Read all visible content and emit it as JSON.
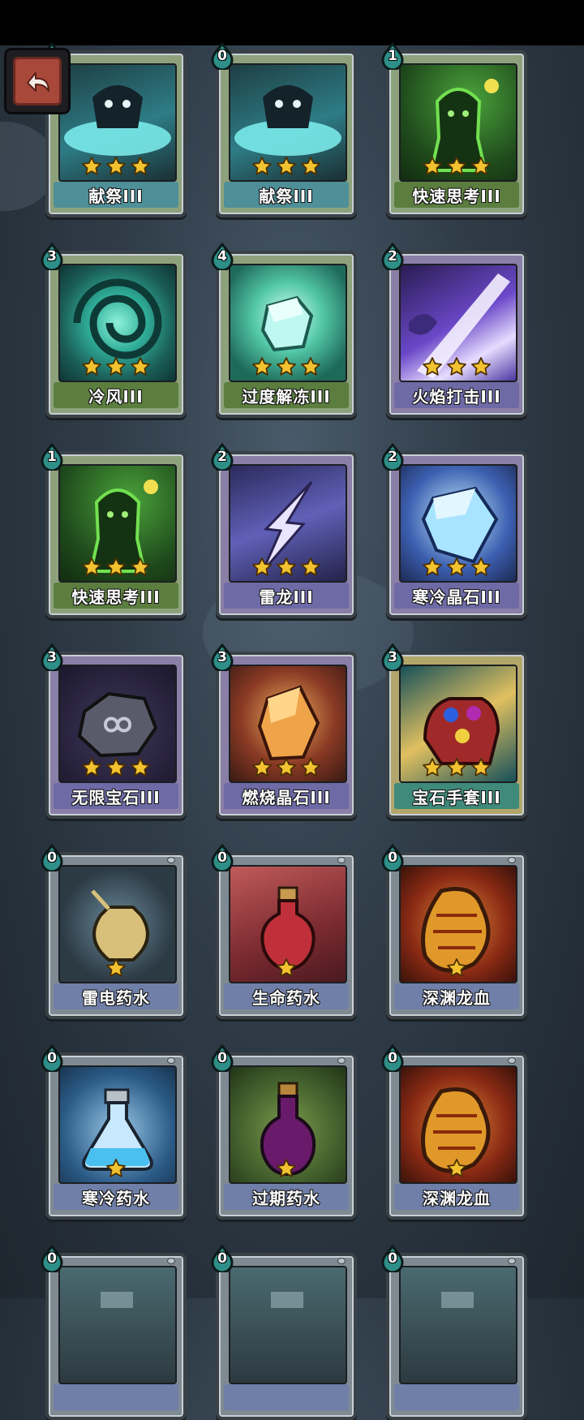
{
  "colors": {
    "star": "#f2c230",
    "cost_drop": "#2e8f88",
    "back_button": "#a8483a"
  },
  "back_button": {
    "icon": "return-arrow-icon"
  },
  "cards": [
    {
      "name": "献祭III",
      "cost": "",
      "stars": 3,
      "frame": "green",
      "label": "teal",
      "art": "sacrifice"
    },
    {
      "name": "献祭III",
      "cost": "0",
      "stars": 3,
      "frame": "green",
      "label": "teal",
      "art": "sacrifice"
    },
    {
      "name": "快速思考III",
      "cost": "1",
      "stars": 3,
      "frame": "green",
      "label": "green",
      "art": "quick-think"
    },
    {
      "name": "冷风III",
      "cost": "3",
      "stars": 3,
      "frame": "green",
      "label": "green",
      "art": "cold-wind"
    },
    {
      "name": "过度解冻III",
      "cost": "4",
      "stars": 3,
      "frame": "green",
      "label": "green",
      "art": "ice-cube"
    },
    {
      "name": "火焰打击III",
      "cost": "2",
      "stars": 3,
      "frame": "purple",
      "label": "purple",
      "art": "flame-strike"
    },
    {
      "name": "快速思考III",
      "cost": "1",
      "stars": 3,
      "frame": "green",
      "label": "green",
      "art": "quick-think"
    },
    {
      "name": "雷龙III",
      "cost": "2",
      "stars": 3,
      "frame": "purple",
      "label": "purple",
      "art": "thunder-dragon"
    },
    {
      "name": "寒冷晶石III",
      "cost": "2",
      "stars": 3,
      "frame": "purple",
      "label": "purple",
      "art": "cold-crystal"
    },
    {
      "name": "无限宝石III",
      "cost": "3",
      "stars": 3,
      "frame": "purple",
      "label": "purple",
      "art": "infinity-gem"
    },
    {
      "name": "燃烧晶石III",
      "cost": "3",
      "stars": 3,
      "frame": "purple",
      "label": "purple",
      "art": "burning-crystal"
    },
    {
      "name": "宝石手套III",
      "cost": "3",
      "stars": 3,
      "frame": "gold",
      "label": "teal2",
      "art": "gem-gauntlet"
    },
    {
      "name": "雷电药水",
      "cost": "0",
      "stars": 1,
      "frame": "grey",
      "label": "blue",
      "art": "thunder-potion"
    },
    {
      "name": "生命药水",
      "cost": "0",
      "stars": 1,
      "frame": "grey",
      "label": "blue",
      "art": "life-potion"
    },
    {
      "name": "深渊龙血",
      "cost": "0",
      "stars": 1,
      "frame": "grey",
      "label": "blue",
      "art": "abyss-blood"
    },
    {
      "name": "寒冷药水",
      "cost": "0",
      "stars": 1,
      "frame": "grey",
      "label": "blue",
      "art": "cold-potion"
    },
    {
      "name": "过期药水",
      "cost": "0",
      "stars": 1,
      "frame": "grey",
      "label": "blue",
      "art": "expired-potion"
    },
    {
      "name": "深渊龙血",
      "cost": "0",
      "stars": 1,
      "frame": "grey",
      "label": "blue",
      "art": "abyss-blood"
    },
    {
      "name": "",
      "cost": "0",
      "stars": 0,
      "frame": "grey",
      "label": "blue",
      "art": "partial"
    },
    {
      "name": "",
      "cost": "0",
      "stars": 0,
      "frame": "grey",
      "label": "blue",
      "art": "partial"
    },
    {
      "name": "",
      "cost": "0",
      "stars": 0,
      "frame": "grey",
      "label": "blue",
      "art": "partial"
    }
  ]
}
